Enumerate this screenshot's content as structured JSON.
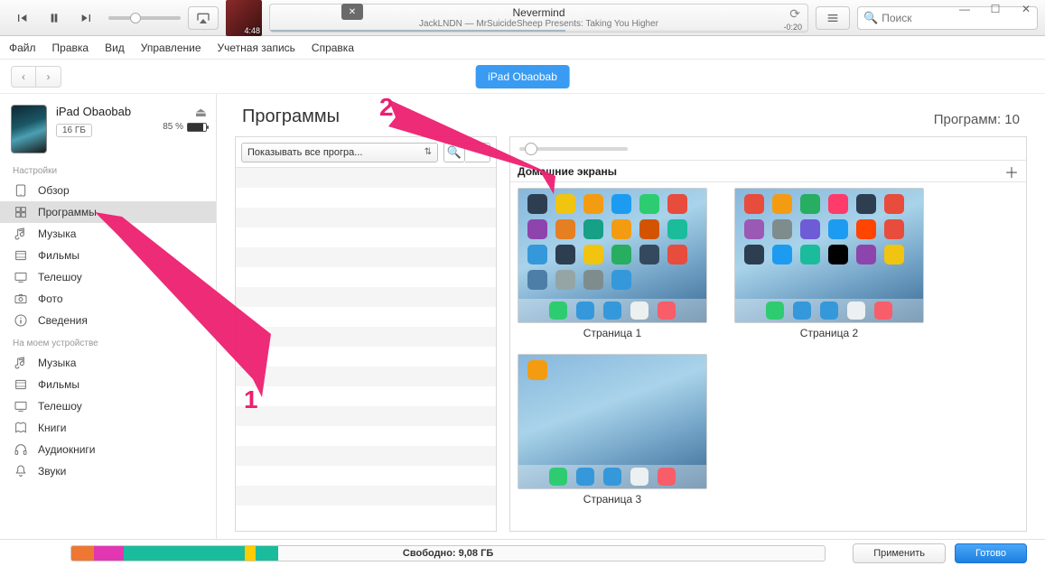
{
  "player": {
    "track_time": "4:48",
    "title": "Nevermind",
    "subtitle": "JackLNDN — MrSuicideSheep Presents: Taking You Higher",
    "remaining": "-0:20"
  },
  "search": {
    "placeholder": "Поиск"
  },
  "menu": {
    "file": "Файл",
    "edit": "Правка",
    "view": "Вид",
    "controls": "Управление",
    "account": "Учетная запись",
    "help": "Справка"
  },
  "device_pill": "iPad Obaobab",
  "device": {
    "name": "iPad Obaobab",
    "capacity": "16 ГБ",
    "battery_pct": "85 %"
  },
  "sidebar": {
    "settings_label": "Настройки",
    "ondevice_label": "На моем устройстве",
    "settings": [
      {
        "label": "Обзор",
        "icon": "ipad"
      },
      {
        "label": "Программы",
        "icon": "apps"
      },
      {
        "label": "Музыка",
        "icon": "music"
      },
      {
        "label": "Фильмы",
        "icon": "film"
      },
      {
        "label": "Телешоу",
        "icon": "tv"
      },
      {
        "label": "Фото",
        "icon": "camera"
      },
      {
        "label": "Сведения",
        "icon": "info"
      }
    ],
    "ondevice": [
      {
        "label": "Музыка",
        "icon": "music"
      },
      {
        "label": "Фильмы",
        "icon": "film"
      },
      {
        "label": "Телешоу",
        "icon": "tv"
      },
      {
        "label": "Книги",
        "icon": "books"
      },
      {
        "label": "Аудиокниги",
        "icon": "headphones"
      },
      {
        "label": "Звуки",
        "icon": "bell"
      }
    ]
  },
  "content": {
    "title": "Программы",
    "count_label": "Программ: 10",
    "filter_label": "Показывать все програ...",
    "home_screens_label": "Домашние экраны",
    "pages": [
      "Страница 1",
      "Страница 2",
      "Страница 3"
    ]
  },
  "footer": {
    "free_label": "Свободно: 9,08 ГБ",
    "apply": "Применить",
    "done": "Готово"
  },
  "annotations": {
    "one": "1",
    "two": "2"
  },
  "icon_colors": {
    "page1": [
      "#2c3e50",
      "#f1c40f",
      "#f39c12",
      "#1d9bf0",
      "#2ecc71",
      "#e74c3c",
      "#8e44ad",
      "#e67e22",
      "#16a085",
      "#f39c12",
      "#d35400",
      "#1abc9c",
      "#3498db",
      "#2c3e50",
      "#f1c40f",
      "#27ae60",
      "#34495e",
      "#e74c3c",
      "#4d7ea8",
      "#95a5a6",
      "#7f8c8d",
      "#3498db"
    ],
    "dock1": [
      "#2ecc71",
      "#3498db",
      "#3498db",
      "#ecf0f1",
      "#f85d6a"
    ],
    "page2": [
      "#e74c3c",
      "#f39c12",
      "#27ae60",
      "#ff3b6b",
      "#2c3e50",
      "#e74c3c",
      "#9b59b6",
      "#7f8c8d",
      "#6e5bd6",
      "#1d9bf0",
      "#ff4500",
      "#e74c3c",
      "#2c3e50",
      "#1d9bf0",
      "#1abc9c",
      "#000000",
      "#8e44ad",
      "#f1c40f"
    ],
    "dock2": [
      "#2ecc71",
      "#3498db",
      "#3498db",
      "#ecf0f1",
      "#f85d6a"
    ],
    "page3": [
      "#f39c12"
    ],
    "dock3": [
      "#2ecc71",
      "#3498db",
      "#3498db",
      "#ecf0f1",
      "#f85d6a"
    ]
  }
}
